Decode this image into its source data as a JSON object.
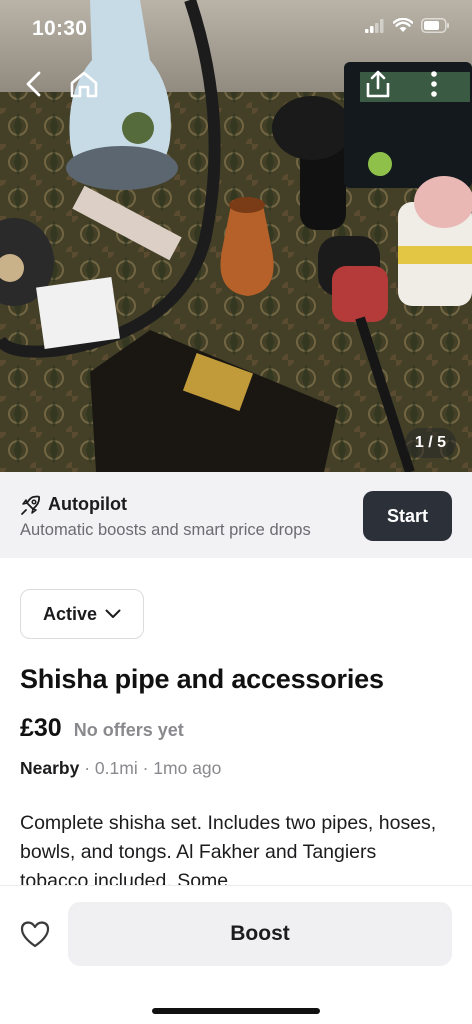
{
  "status_bar": {
    "time": "10:30"
  },
  "gallery": {
    "counter": "1 / 5"
  },
  "autopilot": {
    "title": "Autopilot",
    "subtitle": "Automatic boosts and smart price drops",
    "start_label": "Start"
  },
  "listing": {
    "status": "Active",
    "title": "Shisha pipe and accessories",
    "price": "£30",
    "offers": "No offers yet",
    "location": "Nearby",
    "distance": "0.1mi",
    "age": "1mo ago",
    "description": "Complete shisha set.  Includes two pipes, hoses, bowls, and tongs.  Al Fakher and Tangiers tobacco included.  Some"
  },
  "bottom_bar": {
    "boost_label": "Boost"
  },
  "icons": [
    "back-icon",
    "home-icon",
    "share-icon",
    "more-icon",
    "rocket-icon",
    "chevron-down-icon",
    "heart-icon"
  ],
  "colors": {
    "start_button": "#2b3039",
    "autopilot_bg": "#f2f2f4",
    "boost_bg": "#f0f0f2"
  }
}
